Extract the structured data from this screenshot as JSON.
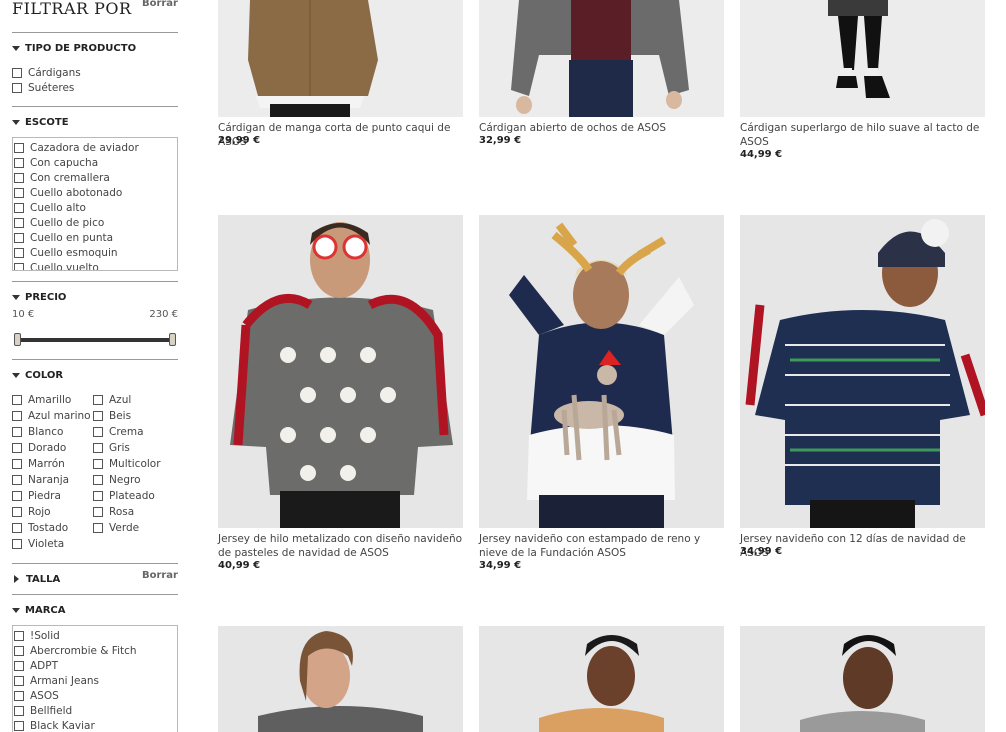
{
  "filters": {
    "title": "FILTRAR POR",
    "clear_label": "Borrar",
    "product_type": {
      "label": "TIPO DE PRODUCTO",
      "options": [
        "Cárdigans",
        "Suéteres"
      ]
    },
    "neckline": {
      "label": "ESCOTE",
      "options": [
        "Cazadora de aviador",
        "Con capucha",
        "Con cremallera",
        "Cuello abotonado",
        "Cuello alto",
        "Cuello de pico",
        "Cuello en punta",
        "Cuello esmoquin",
        "Cuello vuelto"
      ]
    },
    "price": {
      "label": "PRECIO",
      "min_label": "10 €",
      "max_label": "230 €",
      "selected_min_fraction": 0,
      "selected_max_fraction": 1
    },
    "color": {
      "label": "COLOR",
      "col1": [
        "Amarillo",
        "Azul marino",
        "Blanco",
        "Dorado",
        "Marrón",
        "Naranja",
        "Piedra",
        "Rojo",
        "Tostado",
        "Violeta"
      ],
      "col2": [
        "Azul",
        "Beis",
        "Crema",
        "Gris",
        "Multicolor",
        "Negro",
        "Plateado",
        "Rosa",
        "Verde"
      ]
    },
    "size": {
      "label": "TALLA",
      "clear_label": "Borrar"
    },
    "brand": {
      "label": "MARCA",
      "options": [
        "!Solid",
        "Abercrombie & Fitch",
        "ADPT",
        "Armani Jeans",
        "ASOS",
        "Bellfield",
        "Black Kaviar"
      ]
    }
  },
  "products": [
    {
      "name": "Cárdigan de manga corta de punto caqui de ASOS",
      "price": "29,99 €"
    },
    {
      "name": "Cárdigan abierto de ochos de ASOS",
      "price": "32,99 €"
    },
    {
      "name": "Cárdigan superlargo de hilo suave al tacto de ASOS",
      "price": "44,99 €"
    },
    {
      "name": "Jersey de hilo metalizado con diseño navideño de pasteles de navidad de ASOS",
      "price": "40,99 €"
    },
    {
      "name": "Jersey navideño con estampado de reno y nieve de la Fundación ASOS",
      "price": "34,99 €"
    },
    {
      "name": "Jersey navideño con 12 días de navidad de ASOS",
      "price": "34,99 €"
    },
    {
      "name": "",
      "price": ""
    },
    {
      "name": "",
      "price": ""
    },
    {
      "name": "",
      "price": ""
    }
  ],
  "colors": {
    "rule": "#999999",
    "text": "#444444",
    "price": "#222222",
    "image_bg": "#e8e8e8"
  }
}
